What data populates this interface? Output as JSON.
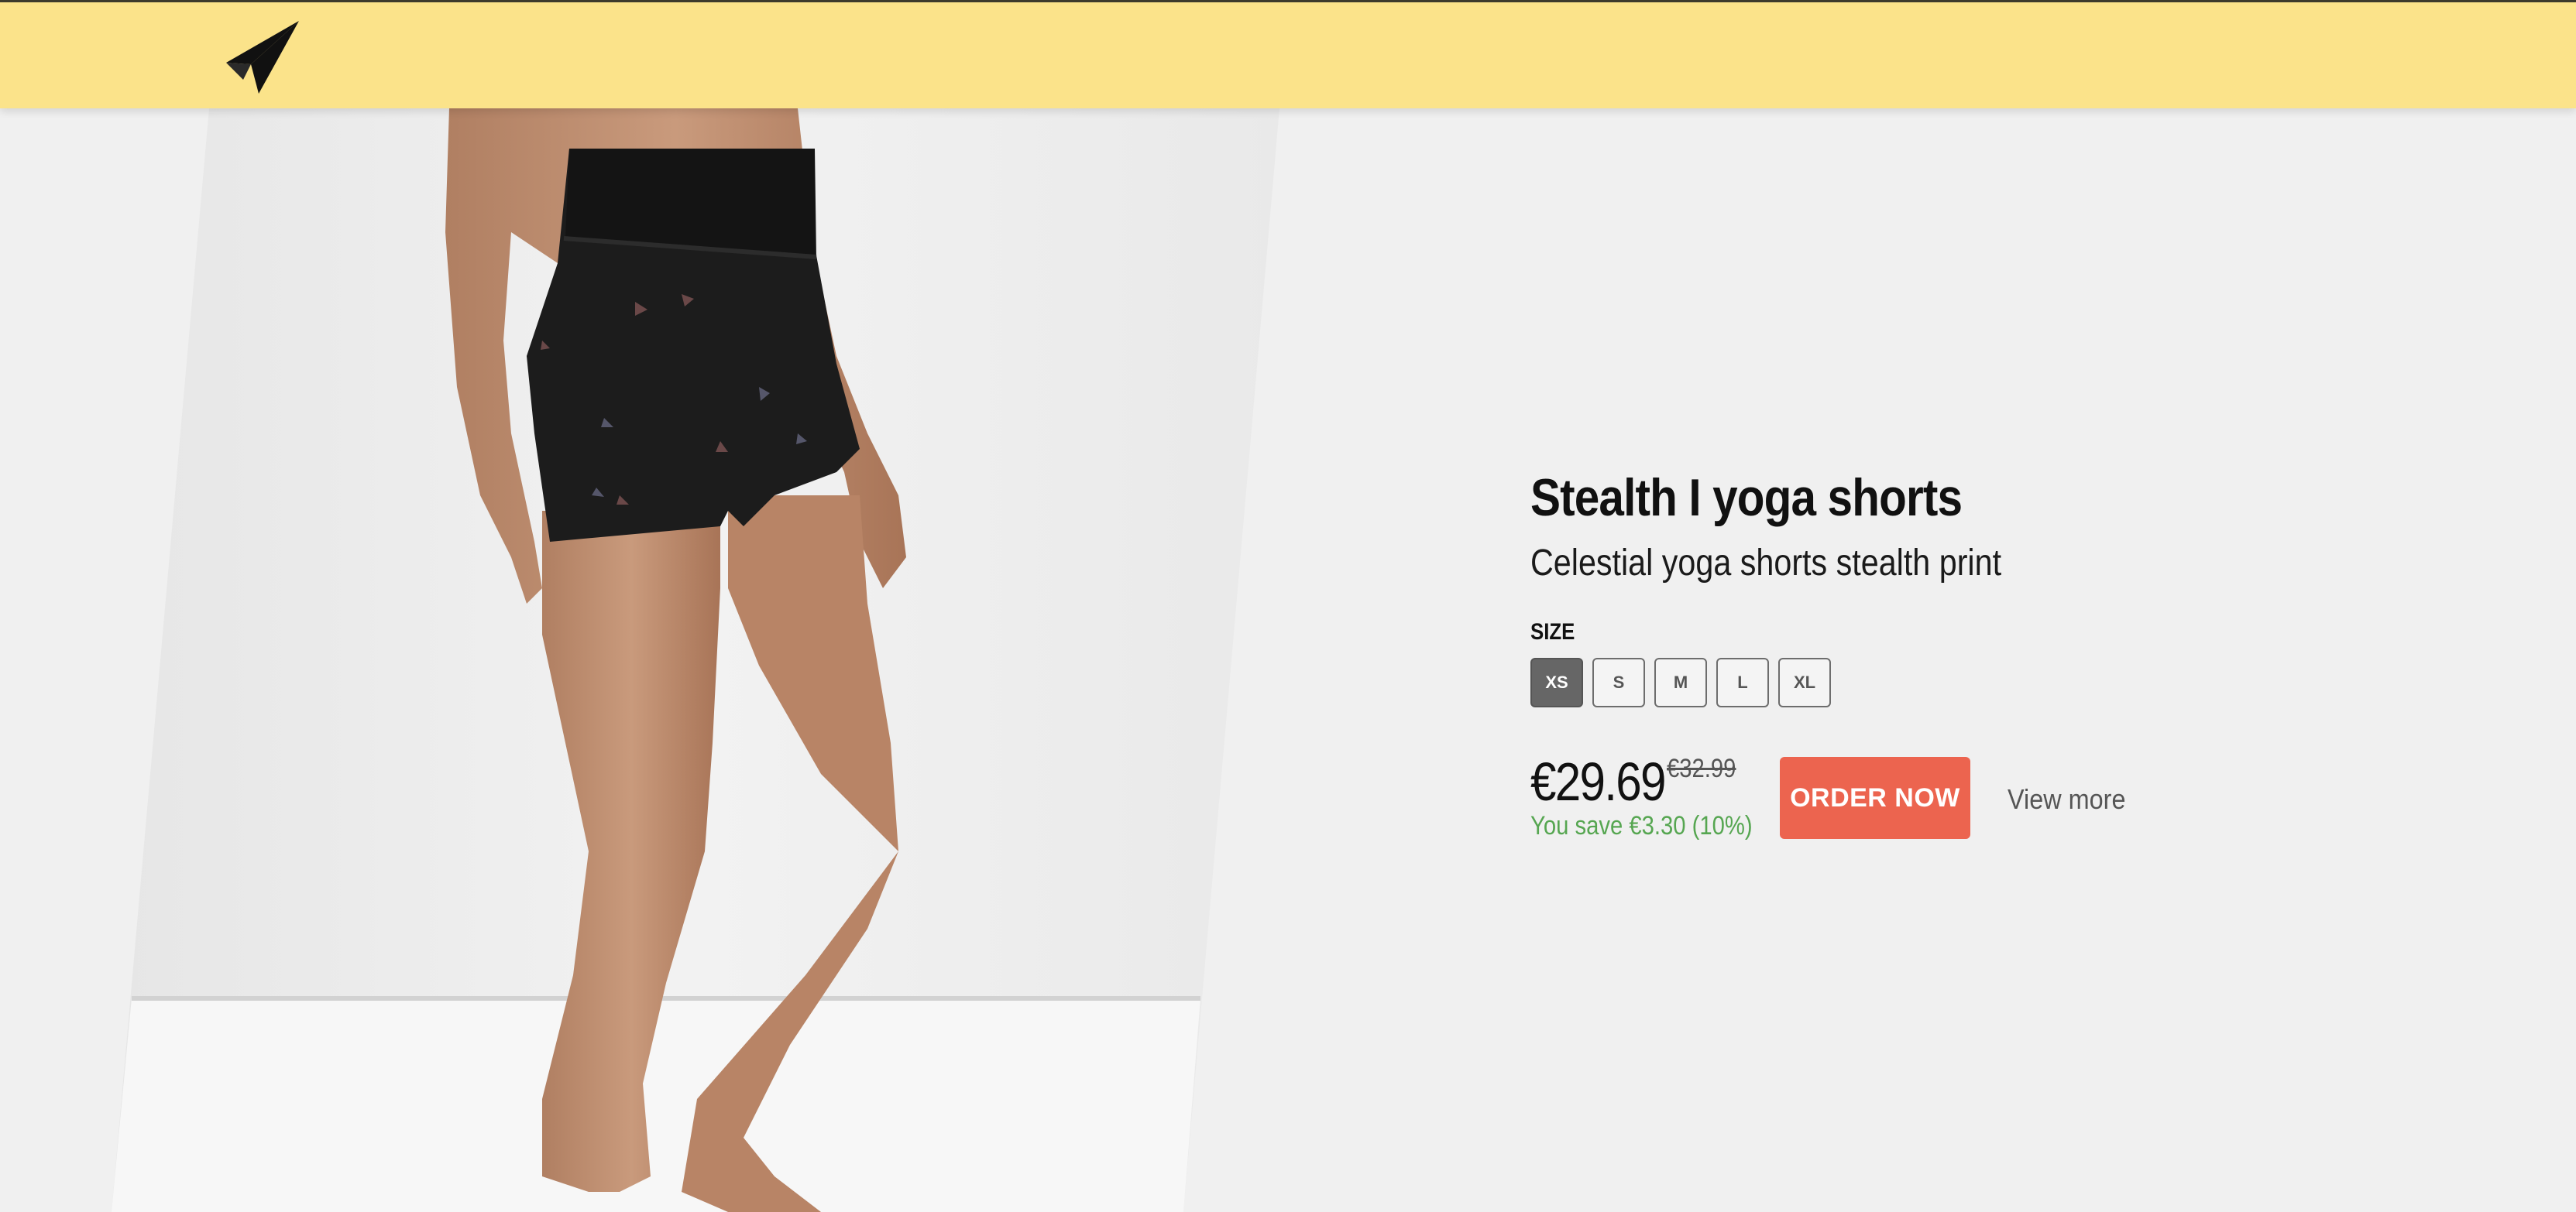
{
  "header": {
    "logo_icon": "paper-plane-logo-icon"
  },
  "product": {
    "image_alt": "model-wearing-yoga-shorts-photo",
    "title": "Stealth I yoga shorts",
    "subtitle": "Celestial yoga shorts stealth print",
    "size_label": "SIZE",
    "sizes": [
      "XS",
      "S",
      "M",
      "L",
      "XL"
    ],
    "selected_size": "XS",
    "price": "€29.69",
    "old_price": "€32.99",
    "savings": "You save €3.30 (10%)",
    "order_label": "ORDER NOW",
    "view_more_label": "View more"
  },
  "colors": {
    "header_bg": "#fbe38a",
    "accent_button": "#ec644f",
    "savings_text": "#56a651",
    "selected_size_bg": "#666666"
  }
}
